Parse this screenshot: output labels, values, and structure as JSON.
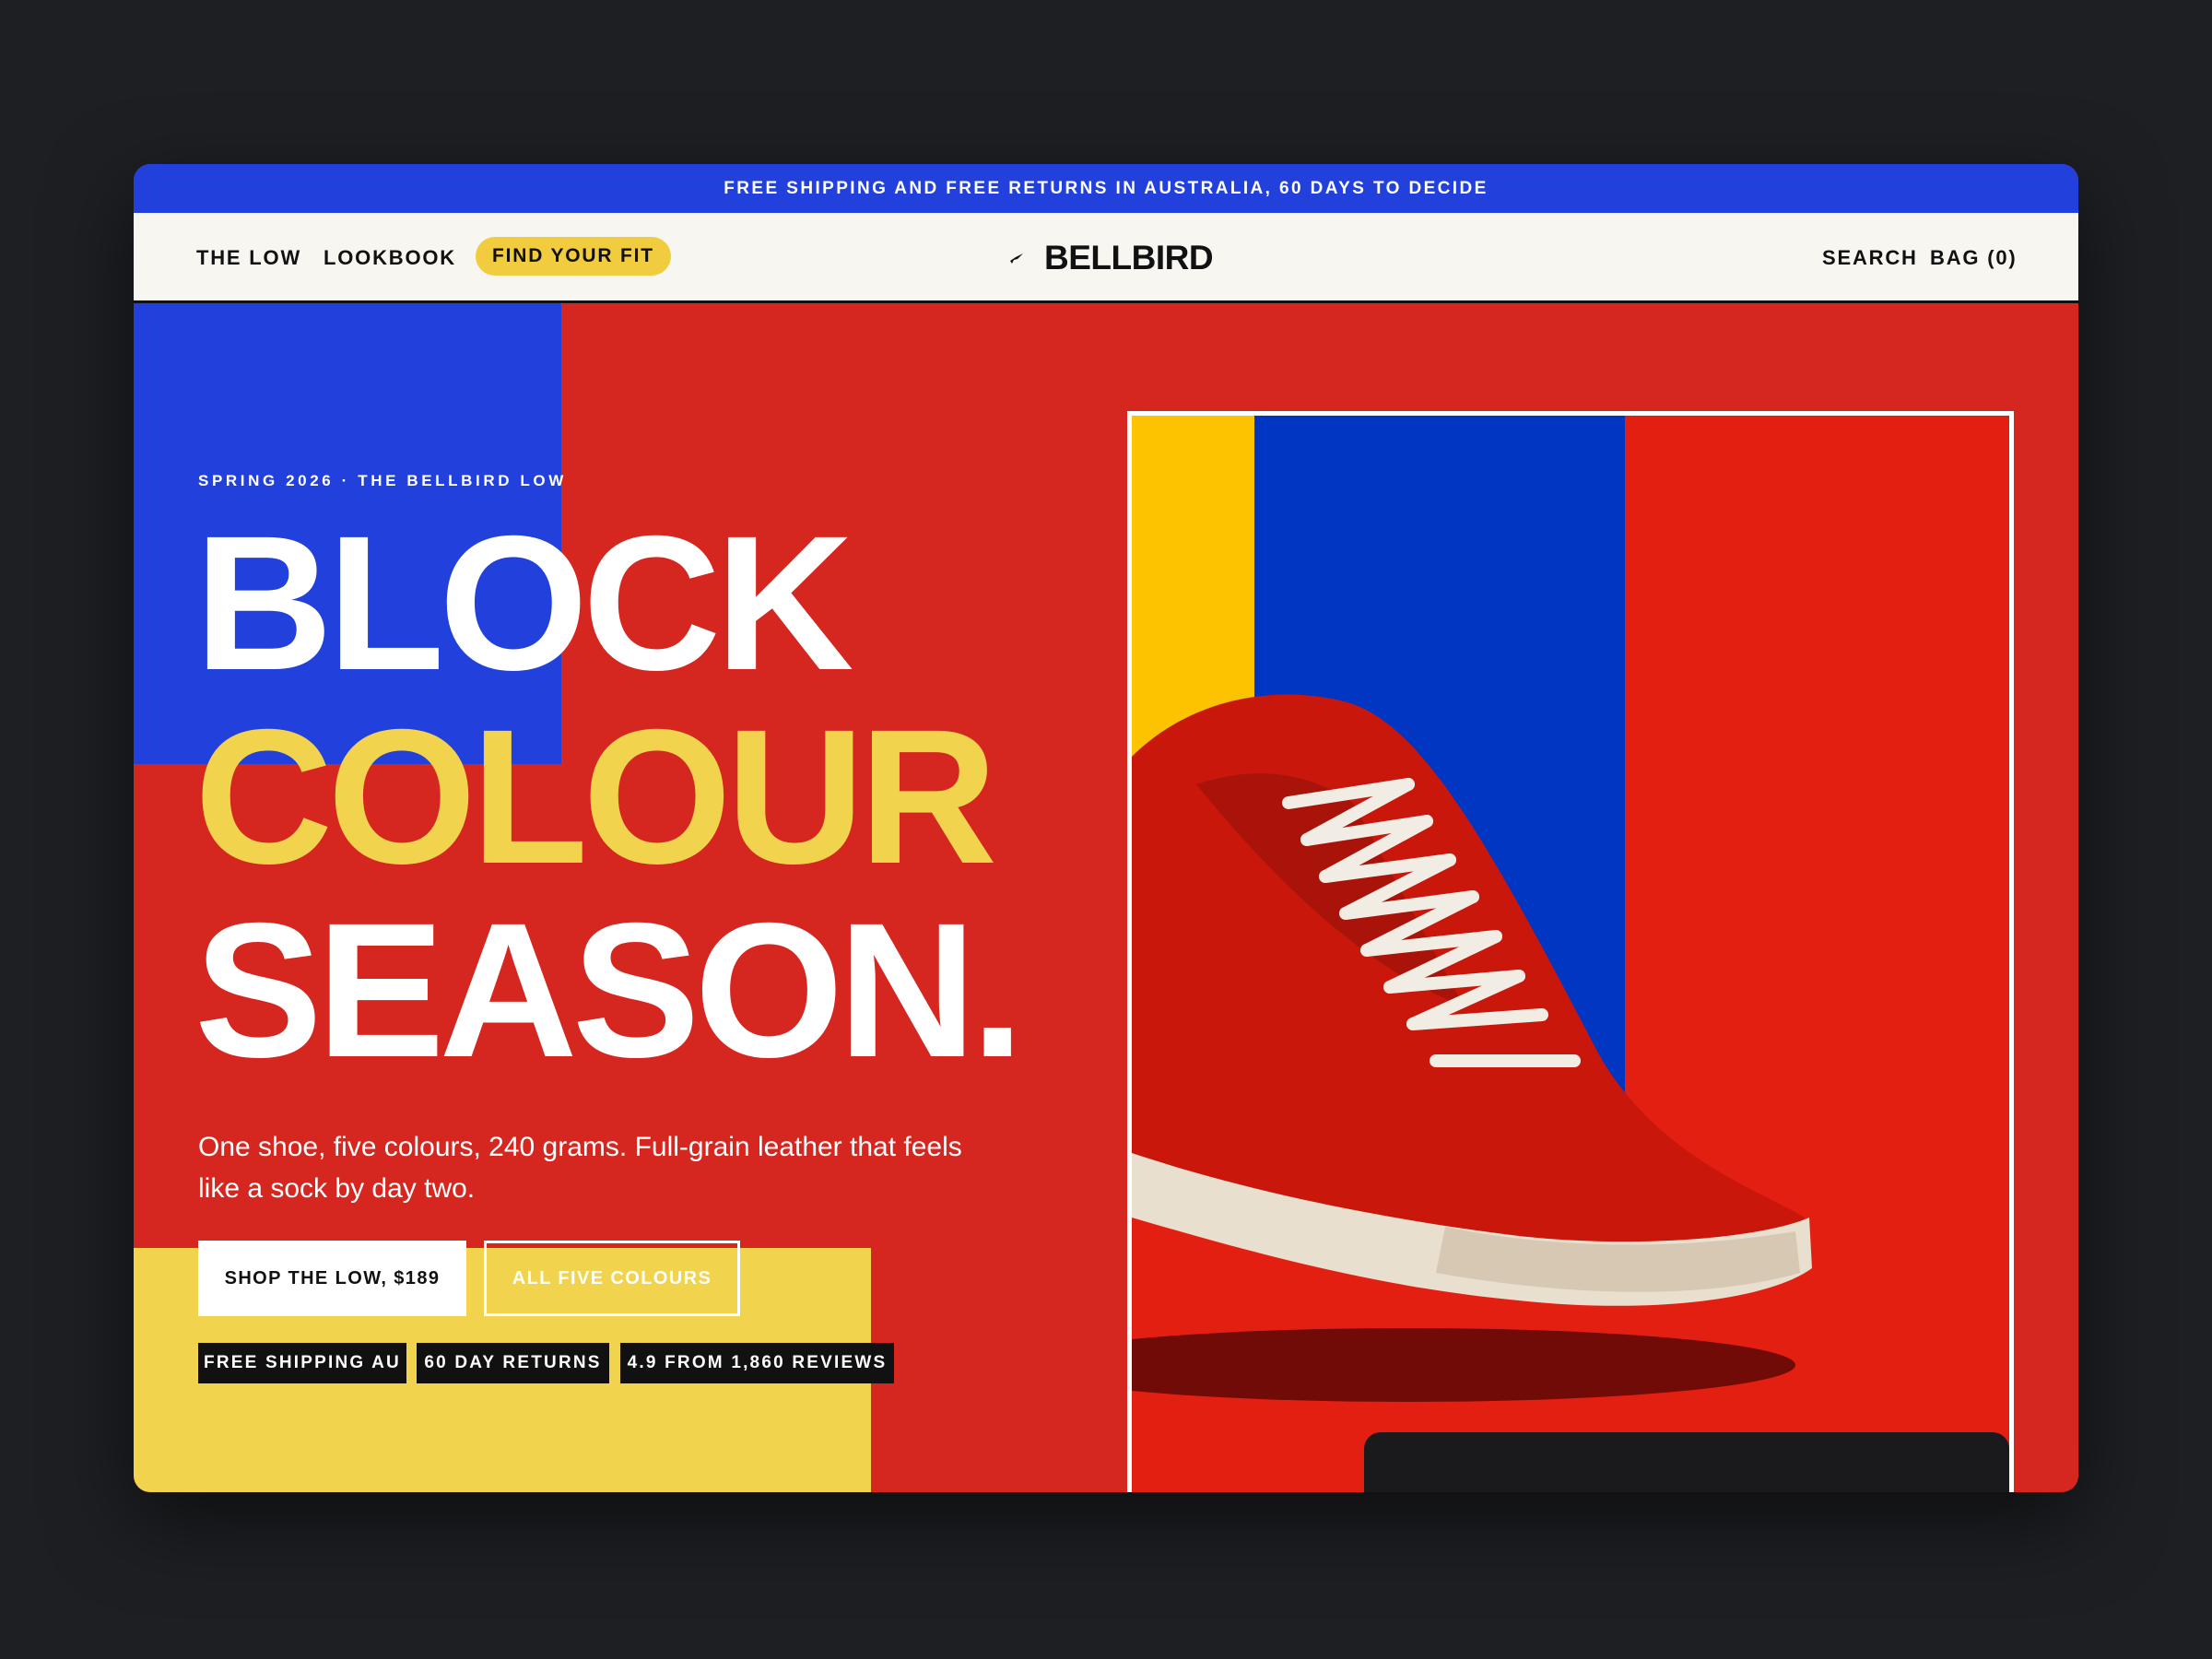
{
  "promo": {
    "text": "FREE SHIPPING AND FREE RETURNS IN AUSTRALIA, 60 DAYS TO DECIDE"
  },
  "nav": {
    "links": [
      "THE LOW",
      "LOOKBOOK"
    ],
    "cta": "FIND YOUR FIT",
    "brand": "BELLBIRD",
    "search": "SEARCH",
    "bag": "BAG (0)"
  },
  "hero": {
    "eyebrow": "SPRING 2026 · THE BELLBIRD LOW",
    "headline": [
      "BLOCK",
      "COLOUR",
      "SEASON."
    ],
    "subcopy": "One shoe, five colours, 240 grams. Full-grain leather that feels like a sock by day two.",
    "primary_cta": "SHOP THE LOW, $189",
    "secondary_cta": "ALL FIVE COLOURS",
    "badges": [
      "FREE SHIPPING AU",
      "60 DAY RETURNS",
      "4.9 FROM 1,860 REVIEWS"
    ]
  },
  "colors": {
    "red": "#d5261f",
    "blue": "#2140dc",
    "yellow": "#f1d34e",
    "cream": "#f8f6f0",
    "ink": "#111111"
  },
  "icons": {
    "brand_mark": "bird-icon"
  }
}
